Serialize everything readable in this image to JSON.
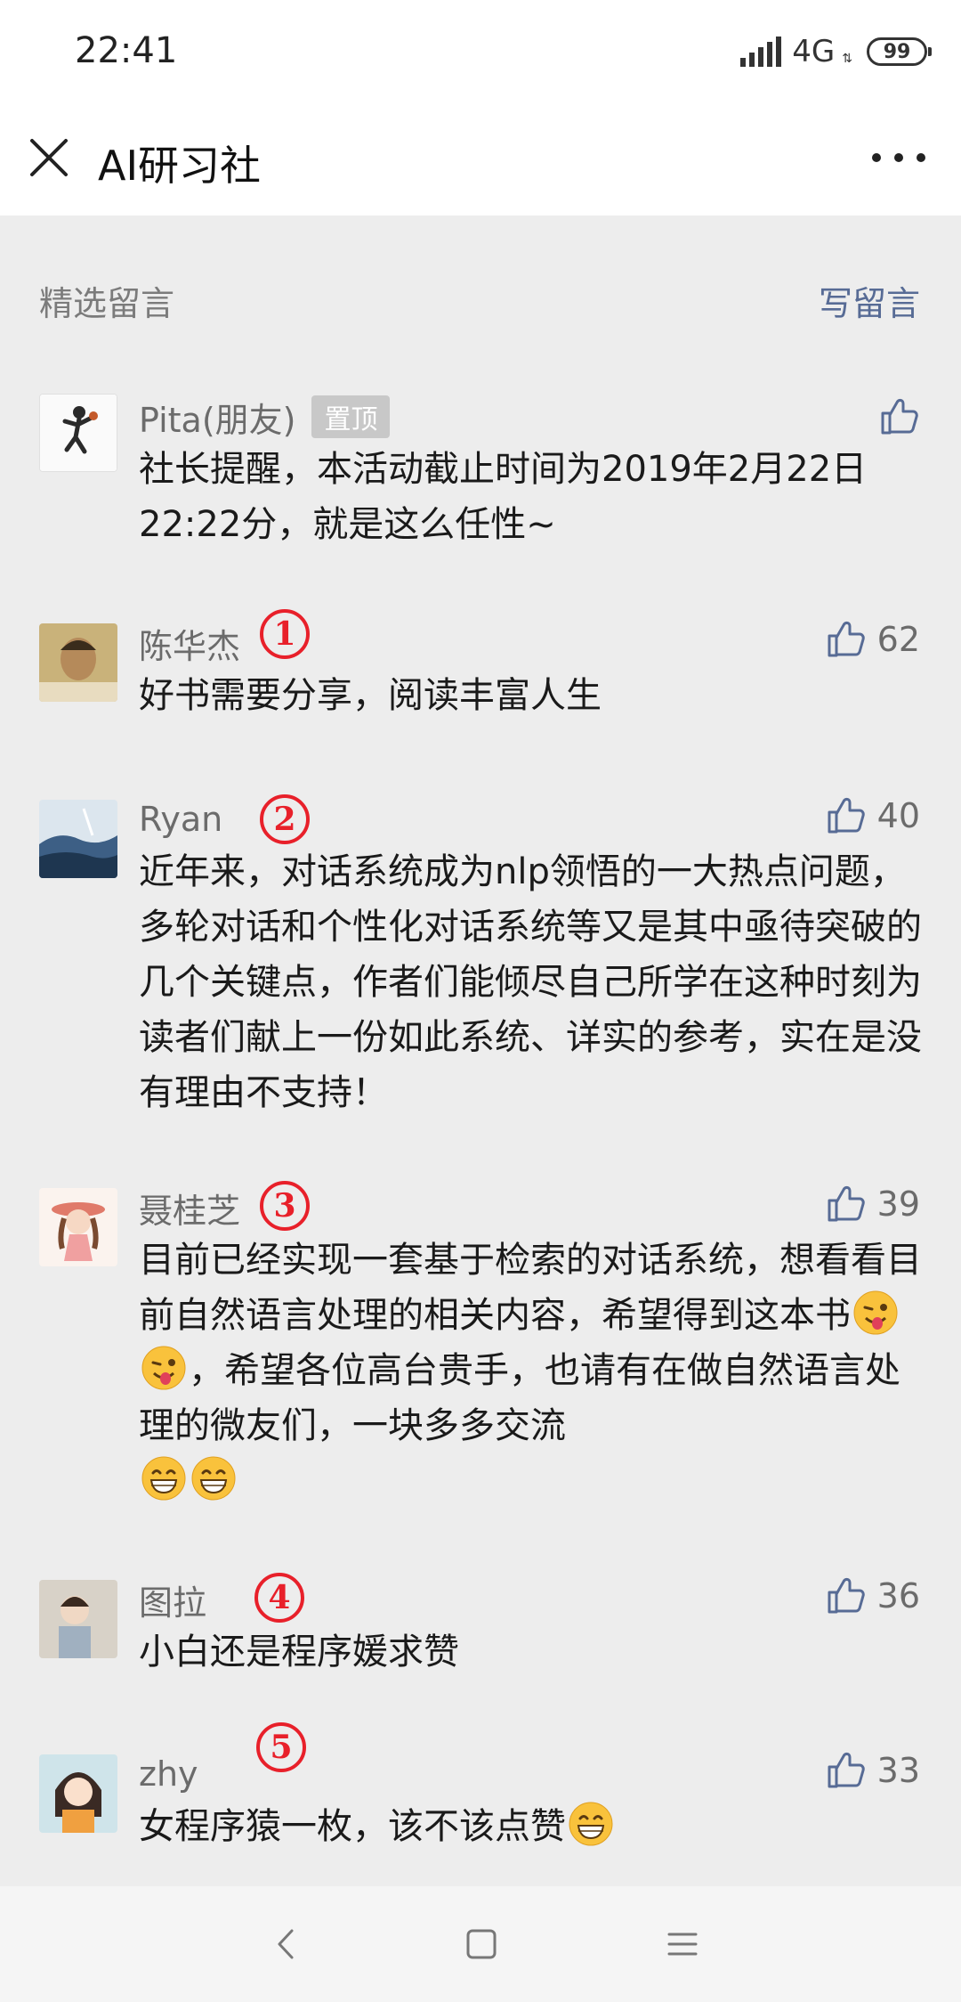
{
  "status": {
    "time": "22:41",
    "network": "4G",
    "battery": "99"
  },
  "header": {
    "title": "AI研习社"
  },
  "comments_section": {
    "label": "精选留言",
    "write_label": "写留言"
  },
  "comments": [
    {
      "author": "Pita(朋友)",
      "badge": "置顶",
      "text": "社长提醒，本活动截止时间为2019年2月22日22:22分，就是这么任性~",
      "likes": ""
    },
    {
      "author": "陈华杰",
      "rank": "1",
      "likes": "62",
      "text": "好书需要分享，阅读丰富人生"
    },
    {
      "author": "Ryan",
      "rank": "2",
      "likes": "40",
      "text": "近年来，对话系统成为nlp领悟的一大热点问题，多轮对话和个性化对话系统等又是其中亟待突破的几个关键点，作者们能倾尽自己所学在这种时刻为读者们献上一份如此系统、详实的参考，实在是没有理由不支持！"
    },
    {
      "author": "聂桂芝",
      "rank": "3",
      "likes": "39",
      "text_1": "目前已经实现一套基于检索的对话系统，想看看目前自然语言处理的相关内容，希望得到这本书",
      "text_2": "，希望各位高台贵手，也请有在做自然语言处理的微友们，一块多多交流"
    },
    {
      "author": "图拉",
      "rank": "4",
      "likes": "36",
      "text": "小白还是程序媛求赞"
    },
    {
      "author": "zhy",
      "rank": "5",
      "likes": "33",
      "text": "女程序猿一枚，该不该点赞"
    }
  ],
  "colors": {
    "link": "#576b95",
    "rank": "#e8202a",
    "background": "#ededed"
  }
}
